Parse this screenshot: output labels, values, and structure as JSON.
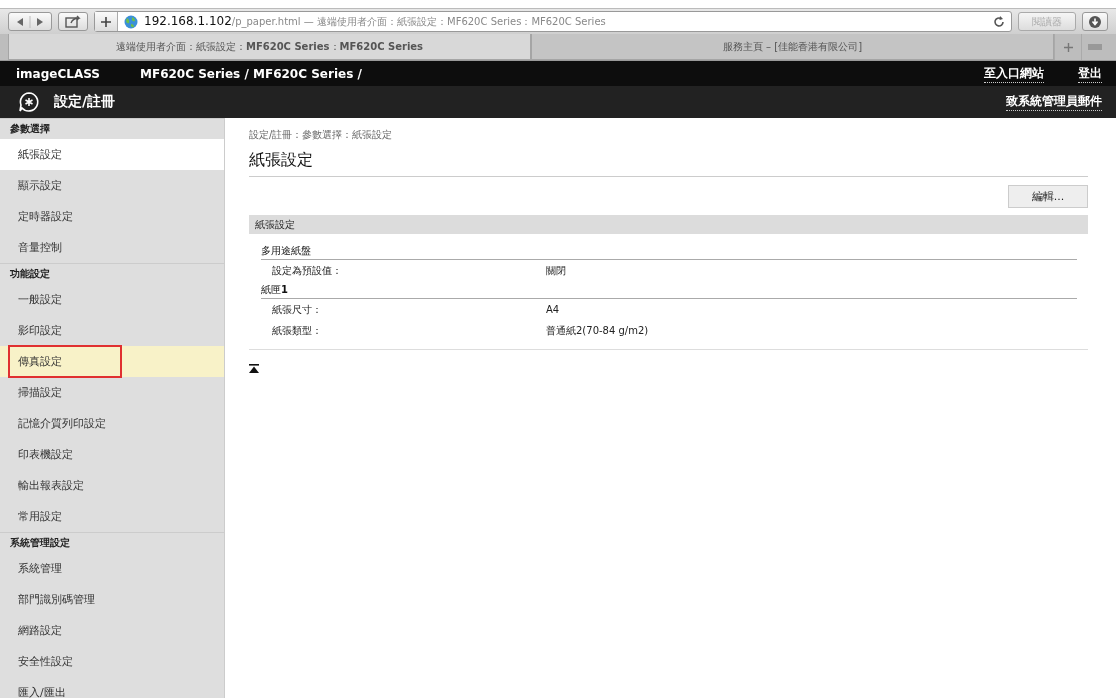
{
  "browser": {
    "address_host": "192.168.1.102",
    "address_rest": "/p_paper.html — 遠端使用者介面：紙張設定：MF620C Series：MF620C Series",
    "reader_button": "閱讀器",
    "tabs": [
      {
        "label": "遠端使用者介面：紙張設定：**MF620C Series**：**MF620C Series**",
        "selected": true
      },
      {
        "label": "服務主頁 – [佳能香港有限公司]",
        "selected": false
      }
    ]
  },
  "header": {
    "brand": "imageCLASS",
    "device_path": "MF620C Series / MF620C Series /",
    "links": [
      "至入口網站",
      "登出"
    ]
  },
  "title_bar": {
    "title": "設定/註冊",
    "link": "致系統管理員郵件"
  },
  "sidebar": [
    {
      "title": "參數選擇",
      "items": [
        {
          "label": "紙張設定",
          "selected": true,
          "highlighted": false
        },
        {
          "label": "顯示設定",
          "selected": false,
          "highlighted": false
        },
        {
          "label": "定時器設定",
          "selected": false,
          "highlighted": false
        },
        {
          "label": "音量控制",
          "selected": false,
          "highlighted": false
        }
      ]
    },
    {
      "title": "功能設定",
      "items": [
        {
          "label": "一般設定",
          "selected": false,
          "highlighted": false
        },
        {
          "label": "影印設定",
          "selected": false,
          "highlighted": false
        },
        {
          "label": "傳真設定",
          "selected": false,
          "highlighted": true
        },
        {
          "label": "掃描設定",
          "selected": false,
          "highlighted": false
        },
        {
          "label": "記憶介質列印設定",
          "selected": false,
          "highlighted": false
        },
        {
          "label": "印表機設定",
          "selected": false,
          "highlighted": false
        },
        {
          "label": "輸出報表設定",
          "selected": false,
          "highlighted": false
        },
        {
          "label": "常用設定",
          "selected": false,
          "highlighted": false
        }
      ]
    },
    {
      "title": "系統管理設定",
      "items": [
        {
          "label": "系統管理",
          "selected": false,
          "highlighted": false
        },
        {
          "label": "部門識別碼管理",
          "selected": false,
          "highlighted": false
        },
        {
          "label": "網路設定",
          "selected": false,
          "highlighted": false
        },
        {
          "label": "安全性設定",
          "selected": false,
          "highlighted": false
        },
        {
          "label": "匯入/匯出",
          "selected": false,
          "highlighted": false
        }
      ]
    }
  ],
  "content": {
    "breadcrumb": "設定/註冊：參數選擇：紙張設定",
    "heading": "紙張設定",
    "edit_button": "編輯...",
    "section_title": "紙張設定",
    "groups": [
      {
        "title": "多用途紙盤",
        "rows": [
          {
            "label": "設定為預設值：",
            "value": "關閉"
          }
        ]
      },
      {
        "title": "紙匣**1**",
        "rows": [
          {
            "label": "紙張尺寸：",
            "value": "A4"
          },
          {
            "label": "紙張類型：",
            "value": "普通紙2(70-84 g/m2)"
          }
        ]
      }
    ]
  }
}
